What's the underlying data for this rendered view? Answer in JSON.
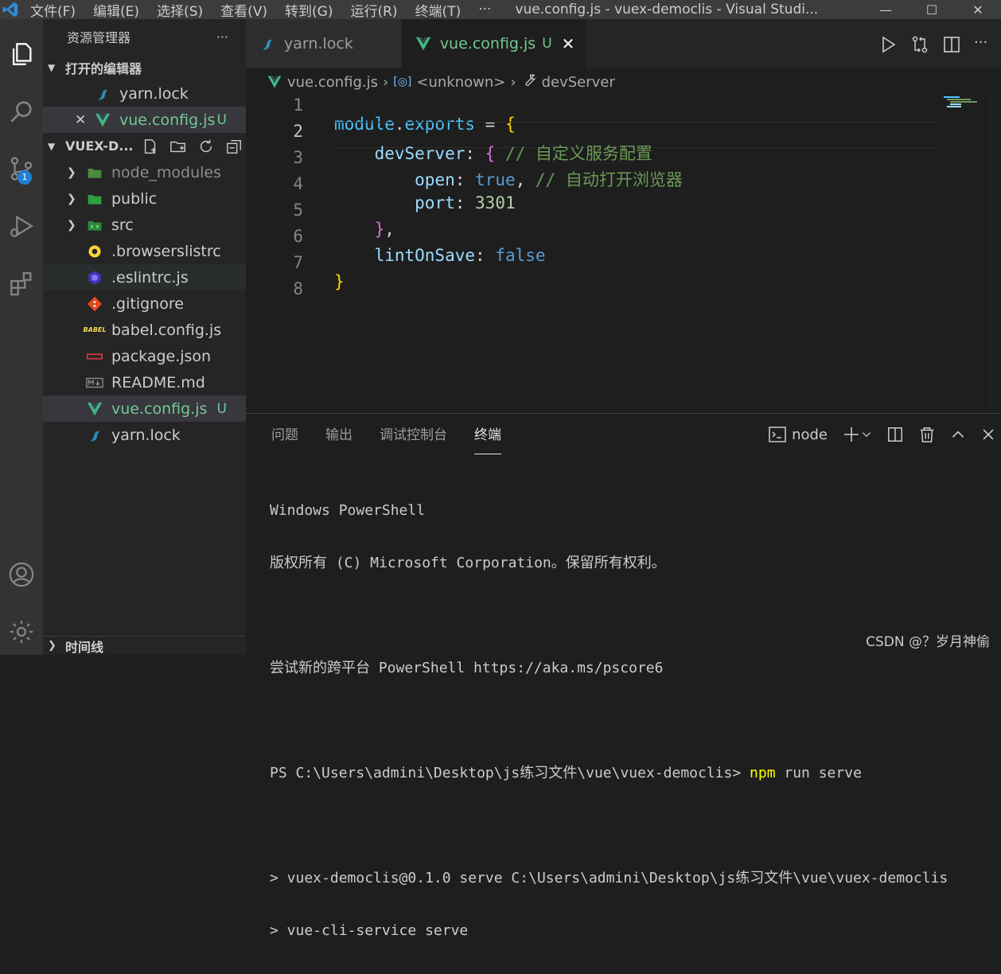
{
  "titlebar": {
    "menu": [
      "文件(F)",
      "编辑(E)",
      "选择(S)",
      "查看(V)",
      "转到(G)",
      "运行(R)",
      "终端(T)"
    ],
    "more": "···",
    "title": "vue.config.js - vuex-democlis - Visual Studi..."
  },
  "activity": {
    "scm_badge": "1"
  },
  "sidebar": {
    "title": "资源管理器",
    "more": "···",
    "open_editors_label": "打开的编辑器",
    "open_editors": [
      {
        "name": "yarn.lock",
        "status": ""
      },
      {
        "name": "vue.config.js",
        "status": "U",
        "close": "✕"
      }
    ],
    "project_label": "VUEX-D...",
    "files": [
      {
        "name": "node_modules",
        "folder": true
      },
      {
        "name": "public",
        "folder": true
      },
      {
        "name": "src",
        "folder": true
      },
      {
        "name": ".browserslistrc"
      },
      {
        "name": ".eslintrc.js"
      },
      {
        "name": ".gitignore"
      },
      {
        "name": "babel.config.js"
      },
      {
        "name": "package.json"
      },
      {
        "name": "README.md"
      },
      {
        "name": "vue.config.js",
        "status": "U"
      },
      {
        "name": "yarn.lock"
      }
    ],
    "timeline_label": "时间线"
  },
  "tabs": [
    {
      "name": "yarn.lock",
      "active": false
    },
    {
      "name": "vue.config.js",
      "status": "U",
      "active": true
    }
  ],
  "breadcrumb": [
    "vue.config.js",
    "<unknown>",
    "devServer"
  ],
  "code": {
    "line_numbers": [
      "1",
      "2",
      "3",
      "4",
      "5",
      "6",
      "7",
      "8"
    ],
    "lines": [
      "module.exports = {",
      "    devServer: { // 自定义服务配置",
      "        open: true, // 自动打开浏览器",
      "        port: 3301",
      "    },",
      "    lintOnSave: false",
      "}",
      ""
    ]
  },
  "panel": {
    "tabs": [
      "问题",
      "输出",
      "调试控制台",
      "终端"
    ],
    "active_tab": "终端",
    "terminal_name": "node",
    "terminal_lines": [
      "Windows PowerShell",
      "版权所有 (C) Microsoft Corporation。保留所有权利。",
      "",
      "尝试新的跨平台 PowerShell https://aka.ms/pscore6",
      "",
      "PS C:\\Users\\admini\\Desktop\\js练习文件\\vue\\vuex-democlis> ",
      "",
      "> vuex-democlis@0.1.0 serve C:\\Users\\admini\\Desktop\\js练习文件\\vue\\vuex-democlis",
      "> vue-cli-service serve"
    ],
    "prompt_command": "npm",
    "prompt_args": " run serve"
  },
  "watermark": "CSDN @？岁月神偷",
  "colors": {
    "accent": "#007acc",
    "untracked": "#73c991",
    "vue_green": "#41b883"
  }
}
